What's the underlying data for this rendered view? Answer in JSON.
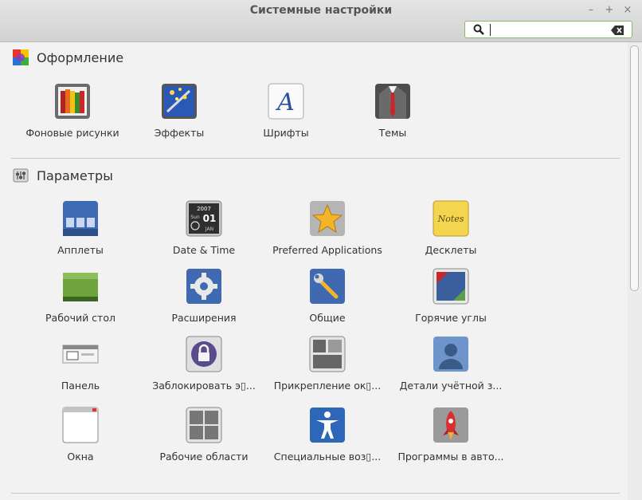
{
  "window": {
    "title": "Системные настройки",
    "minimize": "–",
    "maximize": "+",
    "close": "×"
  },
  "search": {
    "value": "",
    "placeholder": ""
  },
  "sections": [
    {
      "title": "Оформление",
      "items": [
        "Фоновые рисунки",
        "Эффекты",
        "Шрифты",
        "Темы"
      ]
    },
    {
      "title": "Параметры",
      "items": [
        "Апплеты",
        "Date & Time",
        "Preferred Applications",
        "Десклеты",
        "Рабочий стол",
        "Расширения",
        "Общие",
        "Горячие углы",
        "Панель",
        "Заблокировать э▯...",
        "Прикрепление ок▯...",
        "Детали учётной з...",
        "Окна",
        "Рабочие области",
        "Специальные воз▯...",
        "Программы в авто..."
      ]
    }
  ],
  "icons": {
    "date_year": "2007",
    "date_day": "Sun",
    "date_num": "01",
    "date_month": "JAN",
    "note_text": "Notes",
    "font_glyph": "A"
  }
}
